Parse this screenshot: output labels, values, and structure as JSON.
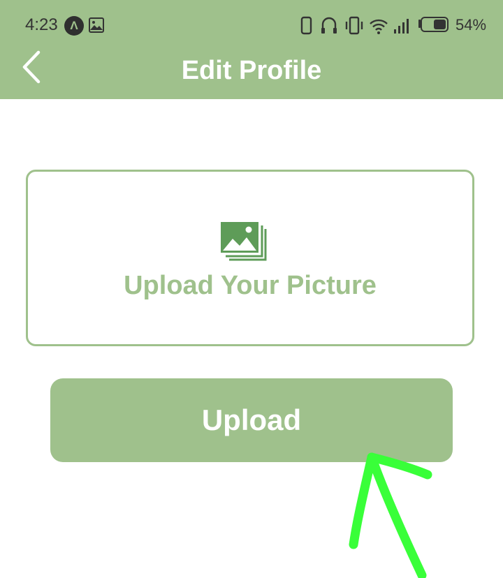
{
  "status_bar": {
    "time": "4:23",
    "app_icon_glyph": "Λ",
    "battery_percent": "54%",
    "icons": [
      "app-notification-icon",
      "gallery-icon",
      "phone-icon",
      "headphones-icon",
      "vibrate-icon",
      "wifi-icon",
      "signal-icon",
      "battery-icon"
    ]
  },
  "header": {
    "title": "Edit Profile",
    "back_icon": "chevron-left-icon"
  },
  "upload_card": {
    "label": "Upload Your Picture",
    "icon": "image-gallery-icon"
  },
  "upload_button": {
    "label": "Upload"
  },
  "colors": {
    "accent": "#9fc18c",
    "icon_green": "#5e9c58",
    "annotation": "#39ff39",
    "status_text": "#333333"
  }
}
